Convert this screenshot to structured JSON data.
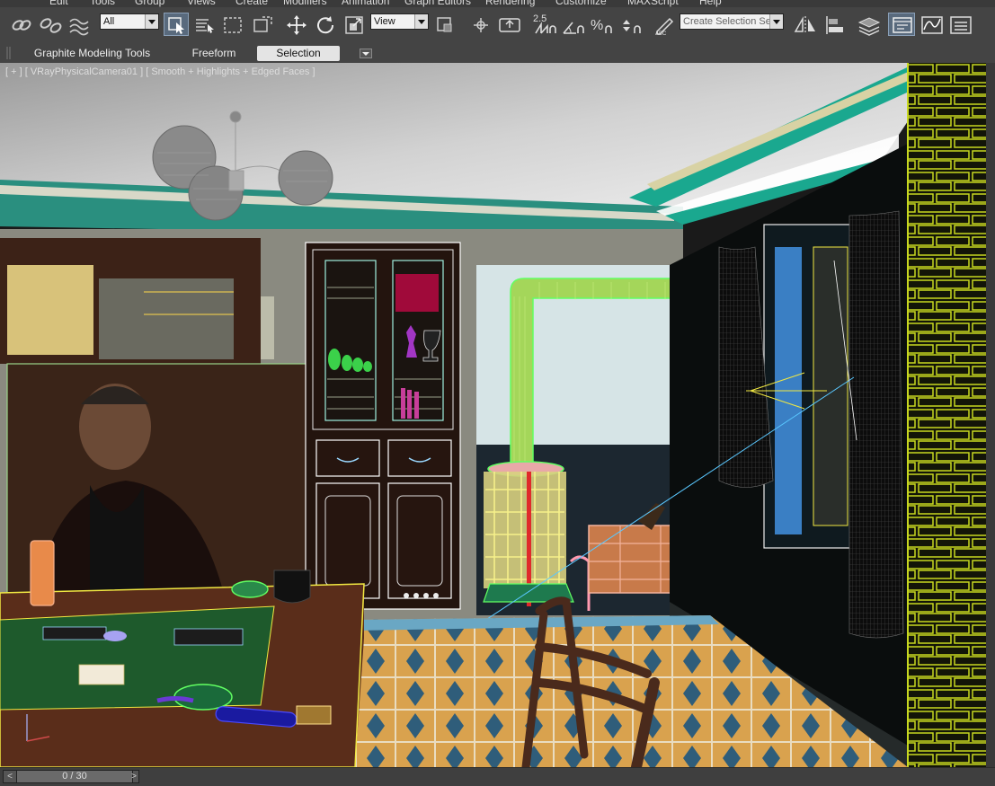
{
  "menu": {
    "items": [
      "Edit",
      "Tools",
      "Group",
      "Views",
      "Create",
      "Modifiers",
      "Animation",
      "Graph Editors",
      "Rendering",
      "Customize",
      "MAXScript",
      "Help"
    ]
  },
  "toolbar": {
    "selection_filter": "All",
    "reference_coord": "View",
    "snap_angle": "2.5",
    "named_selection_placeholder": "Create Selection Se"
  },
  "ribbon": {
    "tabs": [
      "Graphite Modeling Tools",
      "Freeform",
      "Selection"
    ],
    "active_tab": "Selection"
  },
  "viewport": {
    "label": "[ + ] [ VRayPhysicalCamera01 ] [ Smooth + Highlights + Edged Faces ]"
  },
  "timeline": {
    "frame_display": "0 / 30",
    "prev_symbol": "<",
    "next_symbol": ">"
  },
  "colors": {
    "ui_dark": "#444444",
    "selected_tab": "#e4e4e4",
    "wire_green": "#7dff7d",
    "wire_yellow": "#e8f15a",
    "teal_trim": "#1aa88f",
    "brick_yellow": "#c8d820"
  },
  "icons": [
    "link-icon",
    "unlink-icon",
    "bind-space-warp-icon",
    "select-object-icon",
    "select-by-name-icon",
    "rect-region-icon",
    "window-crossing-icon",
    "select-move-icon",
    "select-rotate-icon",
    "select-scale-icon",
    "pivot-icon",
    "manipulate-icon",
    "snap-toggle-icon",
    "angle-snap-icon",
    "percent-snap-icon",
    "spinner-snap-icon",
    "edit-named-selections-icon",
    "mirror-icon",
    "align-icon",
    "layer-manager-icon",
    "scene-explorer-icon",
    "curve-editor-icon",
    "schematic-view-icon"
  ]
}
